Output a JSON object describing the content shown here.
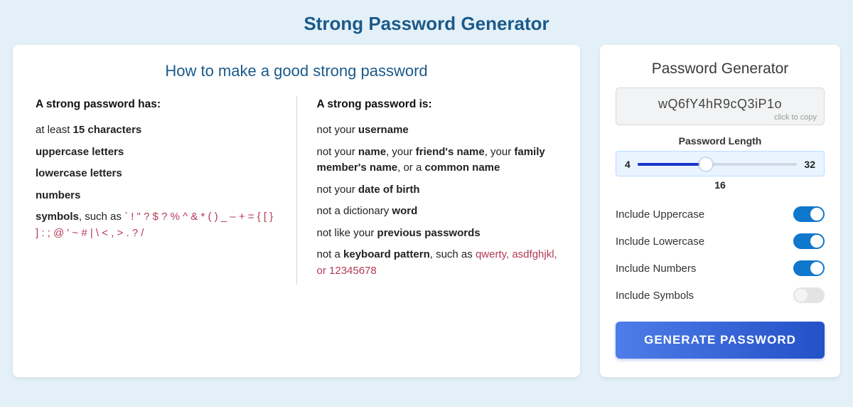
{
  "title": "Strong Password Generator",
  "info": {
    "heading": "How to make a good strong password",
    "col1_heading": "A strong password has:",
    "col1": {
      "i0a": "at least ",
      "i0b": "15 characters",
      "i1": "uppercase letters",
      "i2": "lowercase letters",
      "i3": "numbers",
      "i4a": "symbols",
      "i4b": ", such as ",
      "i4c": "` ! \" ? $ ? % ^ & * ( ) _ – + = { [ } ] : ; @ ' ~ # | \\ < , > . ? /"
    },
    "col2_heading": "A strong password is:",
    "col2": {
      "i0a": "not your ",
      "i0b": "username",
      "i1a": "not your ",
      "i1b": "name",
      "i1c": ", your ",
      "i1d": "friend's name",
      "i1e": ", your ",
      "i1f": "family member's name",
      "i1g": ", or a ",
      "i1h": "common name",
      "i2a": "not your ",
      "i2b": "date of birth",
      "i3a": "not a dictionary ",
      "i3b": "word",
      "i4a": "not like your ",
      "i4b": "previous passwords",
      "i5a": "not a ",
      "i5b": "keyboard pattern",
      "i5c": ", such as ",
      "i5d": "qwerty, asdfghjkl, or 12345678"
    }
  },
  "gen": {
    "heading": "Password Generator",
    "password": "wQ6fY4hR9cQ3iP1o",
    "copy_hint": "click to copy",
    "length_label": "Password Length",
    "min": "4",
    "max": "32",
    "value": "16",
    "opts": {
      "upper": "Include Uppercase",
      "lower": "Include Lowercase",
      "numbers": "Include Numbers",
      "symbols": "Include Symbols"
    },
    "button": "GENERATE PASSWORD"
  }
}
